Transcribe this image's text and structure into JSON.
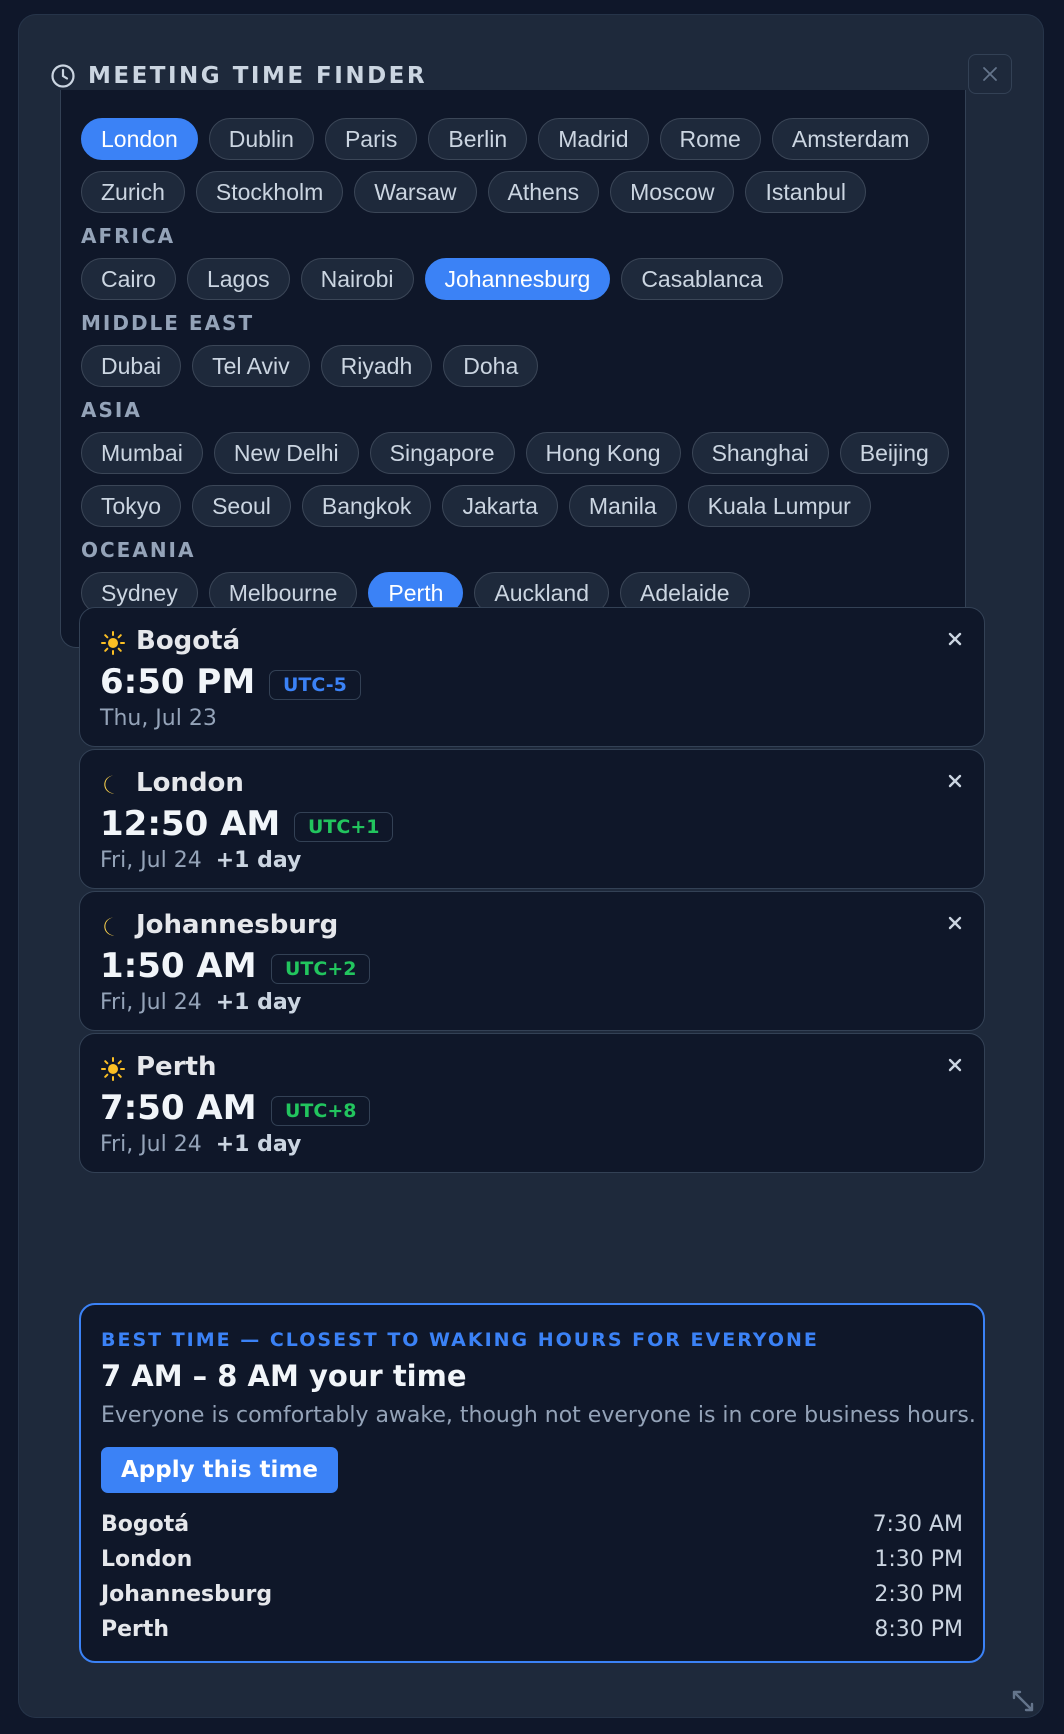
{
  "header": {
    "title": "MEETING TIME FINDER"
  },
  "picker": {
    "regions": [
      {
        "label": "",
        "rows": [
          [
            {
              "name": "London",
              "selected": true
            },
            {
              "name": "Dublin"
            },
            {
              "name": "Paris"
            },
            {
              "name": "Berlin"
            },
            {
              "name": "Madrid"
            },
            {
              "name": "Rome"
            },
            {
              "name": "Amsterdam"
            }
          ],
          [
            {
              "name": "Zurich"
            },
            {
              "name": "Stockholm"
            },
            {
              "name": "Warsaw"
            },
            {
              "name": "Athens"
            },
            {
              "name": "Moscow"
            },
            {
              "name": "Istanbul"
            }
          ]
        ]
      },
      {
        "label": "AFRICA",
        "rows": [
          [
            {
              "name": "Cairo"
            },
            {
              "name": "Lagos"
            },
            {
              "name": "Nairobi"
            },
            {
              "name": "Johannesburg",
              "selected": true
            },
            {
              "name": "Casablanca"
            }
          ]
        ]
      },
      {
        "label": "MIDDLE EAST",
        "rows": [
          [
            {
              "name": "Dubai"
            },
            {
              "name": "Tel Aviv"
            },
            {
              "name": "Riyadh"
            },
            {
              "name": "Doha"
            }
          ]
        ]
      },
      {
        "label": "ASIA",
        "rows": [
          [
            {
              "name": "Mumbai"
            },
            {
              "name": "New Delhi"
            },
            {
              "name": "Singapore"
            },
            {
              "name": "Hong Kong"
            },
            {
              "name": "Shanghai"
            },
            {
              "name": "Beijing"
            }
          ],
          [
            {
              "name": "Tokyo"
            },
            {
              "name": "Seoul"
            },
            {
              "name": "Bangkok"
            },
            {
              "name": "Jakarta"
            },
            {
              "name": "Manila"
            },
            {
              "name": "Kuala Lumpur"
            }
          ]
        ]
      },
      {
        "label": "OCEANIA",
        "rows": [
          [
            {
              "name": "Sydney"
            },
            {
              "name": "Melbourne"
            },
            {
              "name": "Perth",
              "selected": true
            },
            {
              "name": "Auckland"
            },
            {
              "name": "Adelaide"
            }
          ]
        ]
      }
    ]
  },
  "cards": [
    {
      "city": "Bogotá",
      "icon": "sun-icon",
      "time": "6:50 PM",
      "utc": "UTC-5",
      "utc_color": "#3b82f6",
      "date": "Thu, Jul 23",
      "day_offset": ""
    },
    {
      "city": "London",
      "icon": "moon-icon",
      "time": "12:50 AM",
      "utc": "UTC+1",
      "utc_color": "#22c55e",
      "date": "Fri, Jul 24",
      "day_offset": "+1 day"
    },
    {
      "city": "Johannesburg",
      "icon": "moon-icon",
      "time": "1:50 AM",
      "utc": "UTC+2",
      "utc_color": "#22c55e",
      "date": "Fri, Jul 24",
      "day_offset": "+1 day"
    },
    {
      "city": "Perth",
      "icon": "sun-icon",
      "time": "7:50 AM",
      "utc": "UTC+8",
      "utc_color": "#22c55e",
      "date": "Fri, Jul 24",
      "day_offset": "+1 day"
    }
  ],
  "best": {
    "kicker": "BEST TIME — CLOSEST TO WAKING HOURS FOR EVERYONE",
    "range": "7 AM – 8 AM your time",
    "description": "Everyone is comfortably awake, though not everyone is in core business hours.",
    "apply_label": "Apply this time",
    "rows": [
      {
        "city": "Bogotá",
        "time": "7:30 AM"
      },
      {
        "city": "London",
        "time": "1:30 PM"
      },
      {
        "city": "Johannesburg",
        "time": "2:30 PM"
      },
      {
        "city": "Perth",
        "time": "8:30 PM"
      }
    ]
  },
  "colors": {
    "accent": "#3b82f6",
    "positive": "#22c55e",
    "panel": "#1e293b",
    "card": "#0f1729"
  }
}
